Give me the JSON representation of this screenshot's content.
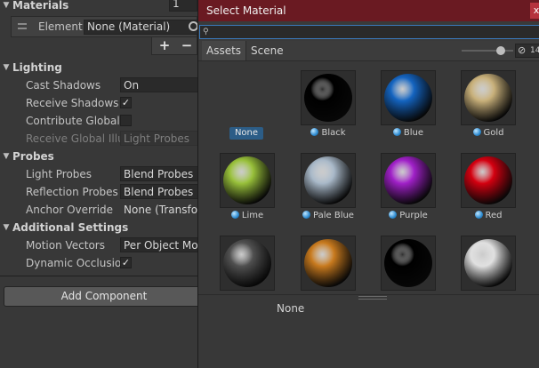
{
  "inspector": {
    "materials": {
      "title": "Materials",
      "size_value": "1",
      "element_label": "Element",
      "element_value": "None (Material)",
      "add_label": "+",
      "remove_label": "−"
    },
    "lighting": {
      "title": "Lighting",
      "cast_shadows_label": "Cast Shadows",
      "cast_shadows_value": "On",
      "receive_shadows_label": "Receive Shadows",
      "receive_shadows_checked": "✓",
      "contribute_gi_label": "Contribute Global Illumination",
      "receive_gi_label": "Receive Global Illumination",
      "receive_gi_value": "Light Probes"
    },
    "probes": {
      "title": "Probes",
      "light_probes_label": "Light Probes",
      "light_probes_value": "Blend Probes",
      "reflection_probes_label": "Reflection Probes",
      "reflection_probes_value": "Blend Probes",
      "anchor_override_label": "Anchor Override",
      "anchor_override_value": "None (Transform)"
    },
    "additional": {
      "title": "Additional Settings",
      "motion_vectors_label": "Motion Vectors",
      "motion_vectors_value": "Per Object Motion",
      "dynamic_occlusion_label": "Dynamic Occlusion",
      "dynamic_occlusion_checked": "✓"
    },
    "add_component_label": "Add Component"
  },
  "dialog": {
    "title": "Select Material",
    "close_label": "x",
    "search": {
      "value": "",
      "placeholder": ""
    },
    "tabs": [
      "Assets",
      "Scene"
    ],
    "hidden_count": "14",
    "slider_value": 0.75,
    "none_label": "None",
    "materials": [
      {
        "name": "Black",
        "color": "#000000"
      },
      {
        "name": "Blue",
        "color": "#1464c0"
      },
      {
        "name": "Gold",
        "color": "#c8b07a"
      },
      {
        "name": "Lime",
        "color": "#98c03a"
      },
      {
        "name": "Pale Blue",
        "color": "#a8b8c8"
      },
      {
        "name": "Purple",
        "color": "#a020c8"
      },
      {
        "name": "Red",
        "color": "#d40010"
      },
      {
        "name": "",
        "color": "#505050"
      },
      {
        "name": "",
        "color": "#c87a1e"
      },
      {
        "name": "",
        "color": "#000000"
      },
      {
        "name": "",
        "color": "#e0e0e0"
      }
    ],
    "preview_label": "None"
  }
}
